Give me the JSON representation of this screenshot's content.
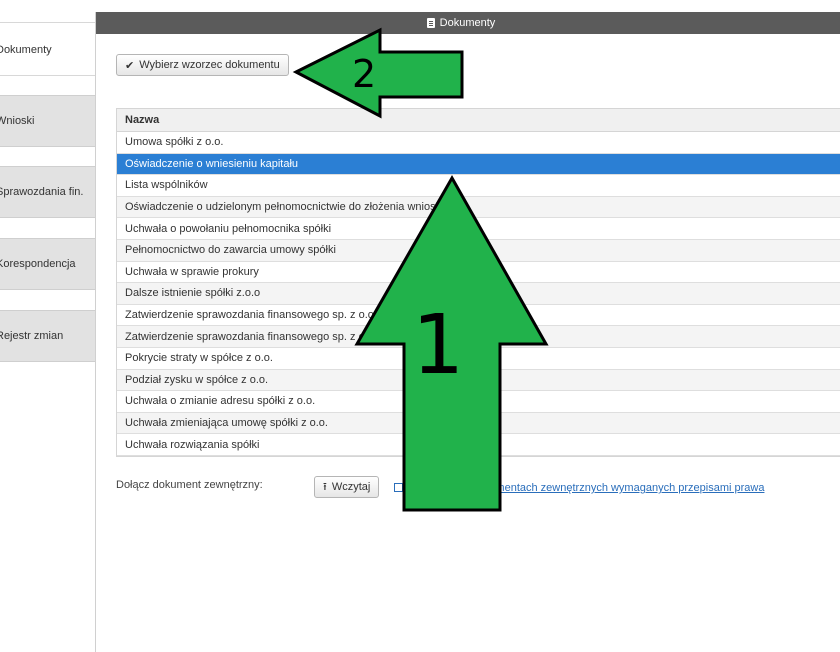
{
  "sidebar": {
    "items": [
      {
        "label": "Dokumenty"
      },
      {
        "label": "Wnioski"
      },
      {
        "label": "Sprawozdania fin."
      },
      {
        "label": "Korespondencja"
      },
      {
        "label": "Rejestr zmian"
      }
    ]
  },
  "panel": {
    "title": "Dokumenty",
    "choose_template_label": "Wybierz wzorzec dokumentu"
  },
  "table": {
    "header": "Nazwa",
    "rows": [
      "Umowa spółki z o.o.",
      "Oświadczenie o wniesieniu kapitału",
      "Lista wspólników",
      "Oświadczenie o udzielonym pełnomocnictwie do złożenia wniosku",
      "Uchwała o powołaniu pełnomocnika spółki",
      "Pełnomocnictwo do zawarcia umowy spółki",
      "Uchwała w sprawie prokury",
      "Dalsze istnienie spółki z.o.o",
      "Zatwierdzenie sprawozdania finansowego sp. z o.o.",
      "Zatwierdzenie sprawozdania finansowego sp. z o.o.",
      "Pokrycie straty w spółce z o.o.",
      "Podział zysku w spółce z o.o.",
      "Uchwała o zmianie adresu spółki z o.o.",
      "Uchwała zmieniająca umowę spółki z o.o.",
      "Uchwała rozwiązania spółki"
    ],
    "selected_index": 1
  },
  "attach": {
    "label": "Dołącz dokument zewnętrzny:",
    "upload_label": "Wczytaj",
    "link_text": "Informacje o dokumentach zewnętrznych wymaganych przepisami prawa"
  },
  "annotations": {
    "arrow_1": "1",
    "arrow_2": "2",
    "arrow_color": "#21b24b"
  },
  "colors": {
    "header_bg": "#5b5b5b",
    "selected_row": "#2b7fd4",
    "link": "#2a6ebb"
  }
}
